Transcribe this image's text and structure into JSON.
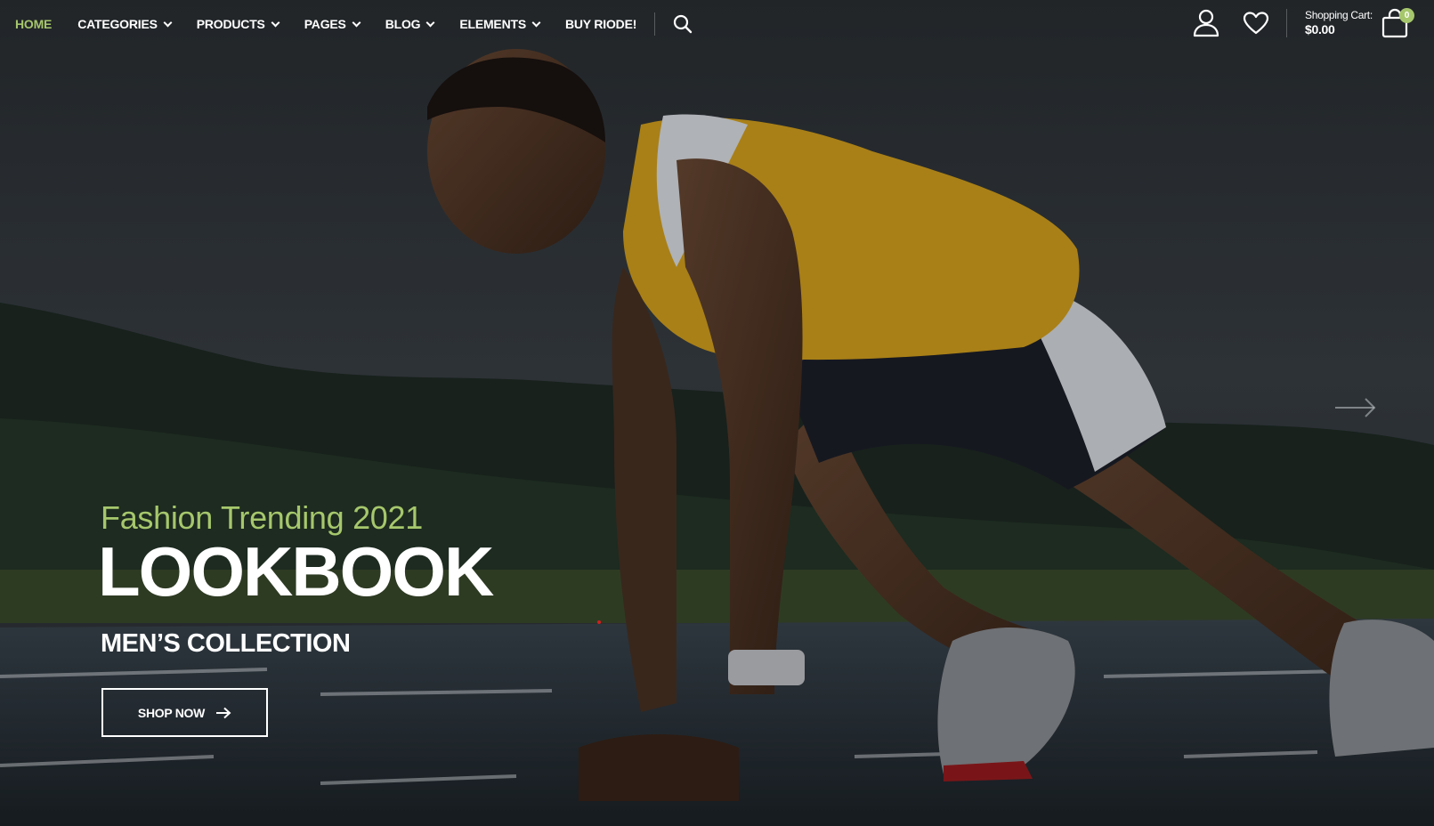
{
  "nav": {
    "items": [
      {
        "label": "HOME",
        "active": true,
        "dropdown": false
      },
      {
        "label": "CATEGORIES",
        "active": false,
        "dropdown": true
      },
      {
        "label": "PRODUCTS",
        "active": false,
        "dropdown": true
      },
      {
        "label": "PAGES",
        "active": false,
        "dropdown": true
      },
      {
        "label": "BLOG",
        "active": false,
        "dropdown": true
      },
      {
        "label": "ELEMENTS",
        "active": false,
        "dropdown": true
      },
      {
        "label": "BUY RIODE!",
        "active": false,
        "dropdown": false
      }
    ],
    "search_icon": "search-icon"
  },
  "header_tools": {
    "account_icon": "user-icon",
    "wishlist_icon": "heart-icon",
    "cart_label": "Shopping Cart:",
    "cart_total": "$0.00",
    "cart_count": "0",
    "cart_icon": "shopping-bag-icon"
  },
  "hero": {
    "eyebrow": "Fashion Trending 2021",
    "headline": "LOOKBOOK",
    "subhead": "MEN’S COLLECTION",
    "cta_label": "SHOP NOW",
    "next_icon": "arrow-right-icon"
  },
  "colors": {
    "accent": "#a6c76c",
    "text": "#ffffff",
    "shirt": "#d9a51e"
  }
}
